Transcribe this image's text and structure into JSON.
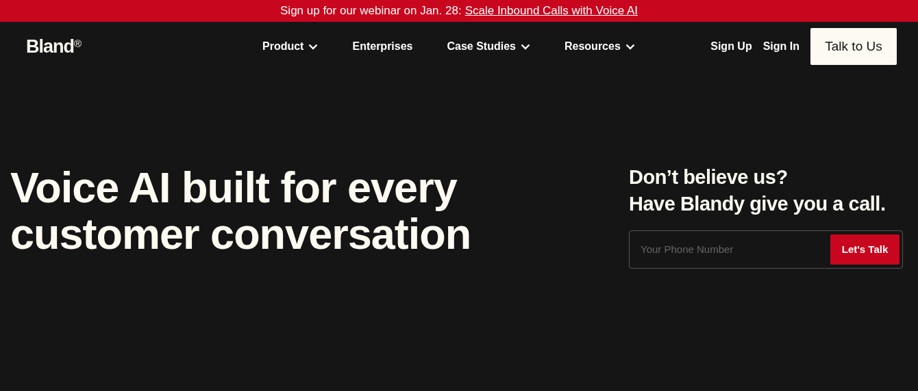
{
  "banner": {
    "text": "Sign up for our webinar on Jan. 28:",
    "link": "Scale Inbound Calls with Voice AI"
  },
  "nav": {
    "logo": "Bland$^{®}$",
    "items": [
      {
        "label": "Product",
        "dropdown": true
      },
      {
        "label": "Enterprises",
        "dropdown": false
      },
      {
        "label": "Case Studies",
        "dropdown": true
      },
      {
        "label": "Resources",
        "dropdown": true
      }
    ],
    "links": [
      "Sign Up",
      "Sign In"
    ],
    "cta": "Talk to Us"
  },
  "hero": {
    "heading": "Voice AI built for every customer conversation",
    "callout": {
      "lines": [
        "Don’t believe us?",
        "Have Blandy give you a call."
      ],
      "phone_field": {
        "placeholder": "Your Phone Number"
      },
      "button": "Let's Talk"
    }
  }
}
